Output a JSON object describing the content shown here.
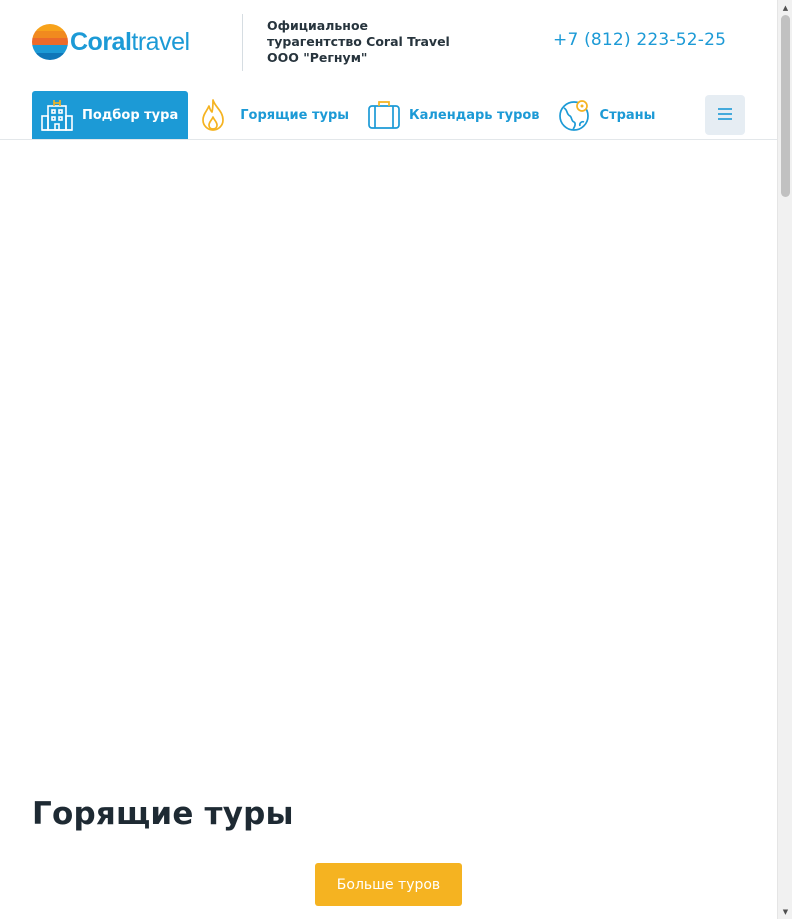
{
  "header": {
    "logo": {
      "word1": "Coral",
      "word2": "travel",
      "icon": "coral-sunset-logo-icon"
    },
    "agency_lines": [
      "Официальное",
      "турагентство Coral Travel",
      "ООО \"Регнум\""
    ],
    "phone": "+7 (812) 223-52-25"
  },
  "nav": {
    "items": [
      {
        "label": "Подбор тура",
        "icon": "hotel-building-icon",
        "active": true
      },
      {
        "label": "Горящие туры",
        "icon": "flame-icon",
        "active": false
      },
      {
        "label": "Календарь туров",
        "icon": "suitcase-icon",
        "active": false
      },
      {
        "label": "Страны",
        "icon": "globe-pin-icon",
        "active": false
      }
    ],
    "menu_icon": "hamburger-menu-icon"
  },
  "main": {
    "section_title": "Горящие туры",
    "more_button": "Больше туров"
  },
  "colors": {
    "brand_blue": "#1c9ad6",
    "accent_orange": "#f5b321",
    "text_dark": "#1e2a33",
    "menu_bg": "#e6edf3"
  }
}
